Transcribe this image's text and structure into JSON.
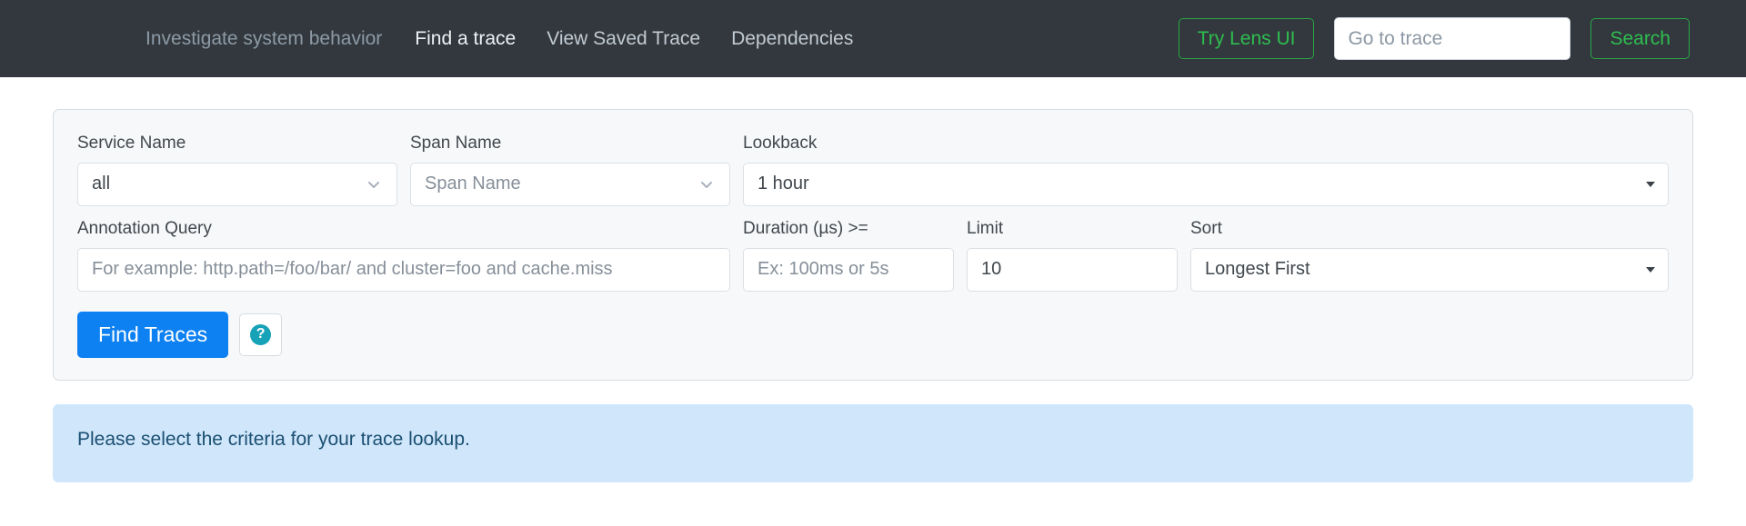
{
  "header": {
    "tagline": "Investigate system behavior",
    "nav_items": [
      {
        "label": "Find a trace",
        "active": true
      },
      {
        "label": "View Saved Trace",
        "active": false
      },
      {
        "label": "Dependencies",
        "active": false
      }
    ],
    "lens_button": "Try Lens UI",
    "trace_search": {
      "placeholder": "Go to trace",
      "value": ""
    },
    "search_button": "Search",
    "background_color": "#32383e",
    "accent_green": "#28a745"
  },
  "search_form": {
    "service_name": {
      "label": "Service Name",
      "value": "all",
      "icon": "chevron-down-icon"
    },
    "span_name": {
      "label": "Span Name",
      "value": "Span Name",
      "icon": "chevron-down-icon"
    },
    "lookback": {
      "label": "Lookback",
      "value": "1 hour",
      "icon": "triangle-down-icon"
    },
    "annotation_query": {
      "label": "Annotation Query",
      "placeholder": "For example: http.path=/foo/bar/ and cluster=foo and cache.miss",
      "value": ""
    },
    "duration": {
      "label": "Duration (µs) >=",
      "placeholder": "Ex: 100ms or 5s",
      "value": ""
    },
    "limit": {
      "label": "Limit",
      "value": "10"
    },
    "sort": {
      "label": "Sort",
      "value": "Longest First",
      "icon": "triangle-down-icon"
    },
    "find_button": "Find Traces",
    "help_button_icon": "question-mark-icon",
    "help_glyph": "?",
    "find_button_color": "#0d80f2",
    "help_icon_color": "#17a2b8"
  },
  "alert": {
    "message": "Please select the criteria for your trace lookup.",
    "background_color": "#cfe6fb",
    "text_color": "#1b4f72"
  }
}
